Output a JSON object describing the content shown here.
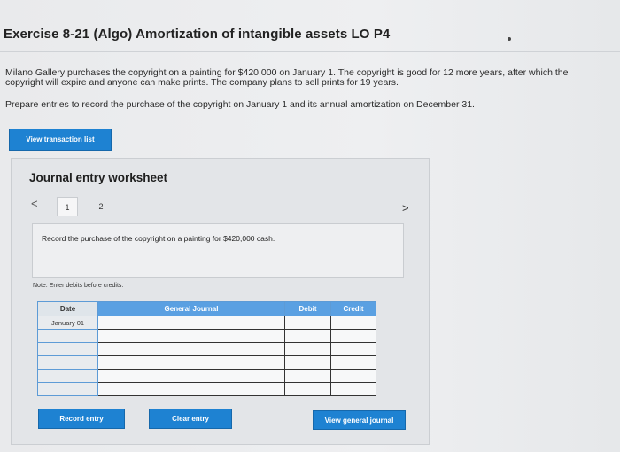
{
  "header": {
    "title": "Exercise 8-21 (Algo) Amortization of intangible assets LO P4"
  },
  "problem": {
    "paragraph": "Milano Gallery purchases the copyright on a painting for $420,000 on January 1. The copyright is good for 12 more years, after which the copyright will expire and anyone can make prints. The company plans to sell prints for 19 years.",
    "instructions": "Prepare entries to record the purchase of the copyright on January 1 and its annual amortization on December 31."
  },
  "buttons": {
    "view_transaction_list": "View transaction list",
    "record_entry": "Record entry",
    "clear_entry": "Clear entry",
    "view_general_journal": "View general journal"
  },
  "worksheet": {
    "title": "Journal entry worksheet",
    "nav_prev": "<",
    "nav_next": ">",
    "tabs": [
      "1",
      "2"
    ],
    "instruction": "Record the purchase of the copyright on a painting for $420,000 cash.",
    "note": "Note: Enter debits before credits."
  },
  "journal": {
    "headers": {
      "date": "Date",
      "general_journal": "General Journal",
      "debit": "Debit",
      "credit": "Credit"
    },
    "rows": [
      {
        "date": "January 01",
        "account": "",
        "debit": "",
        "credit": ""
      },
      {
        "date": "",
        "account": "",
        "debit": "",
        "credit": ""
      },
      {
        "date": "",
        "account": "",
        "debit": "",
        "credit": ""
      },
      {
        "date": "",
        "account": "",
        "debit": "",
        "credit": ""
      },
      {
        "date": "",
        "account": "",
        "debit": "",
        "credit": ""
      },
      {
        "date": "",
        "account": "",
        "debit": "",
        "credit": ""
      }
    ]
  },
  "colors": {
    "button_blue": "#1e82d2",
    "table_header_blue": "#5aa0e2"
  }
}
